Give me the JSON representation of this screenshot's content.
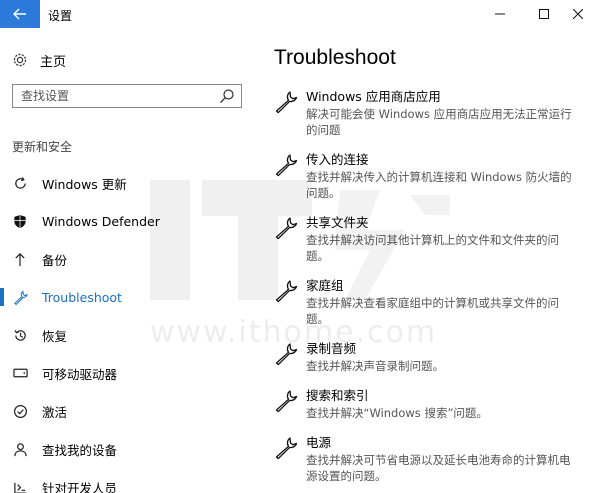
{
  "window": {
    "title": "设置",
    "back_icon": "arrow-left-icon",
    "controls": {
      "minimize": "–",
      "maximize": "☐",
      "close": "✕"
    }
  },
  "sidebar": {
    "home_label": "主页",
    "search_placeholder": "查找设置",
    "section_label": "更新和安全",
    "items": [
      {
        "label": "Windows 更新",
        "icon": "refresh-icon",
        "active": false
      },
      {
        "label": "Windows Defender",
        "icon": "shield-icon",
        "active": false
      },
      {
        "label": "备份",
        "icon": "arrow-up-icon",
        "active": false
      },
      {
        "label": "Troubleshoot",
        "icon": "wrench-icon",
        "active": true
      },
      {
        "label": "恢复",
        "icon": "history-icon",
        "active": false
      },
      {
        "label": "可移动驱动器",
        "icon": "drive-icon",
        "active": false
      },
      {
        "label": "激活",
        "icon": "check-circle-icon",
        "active": false
      },
      {
        "label": "查找我的设备",
        "icon": "person-icon",
        "active": false
      },
      {
        "label": "针对开发人员",
        "icon": "developer-icon",
        "active": false
      }
    ]
  },
  "main": {
    "title": "Troubleshoot",
    "items": [
      {
        "title": "Windows 应用商店应用",
        "desc": "解决可能会使 Windows 应用商店应用无法正常运行的问题"
      },
      {
        "title": "传入的连接",
        "desc": "查找并解决传入的计算机连接和 Windows 防火墙的问题。"
      },
      {
        "title": "共享文件夹",
        "desc": "查找并解决访问其他计算机上的文件和文件夹的问题。"
      },
      {
        "title": "家庭组",
        "desc": "查找并解决查看家庭组中的计算机或共享文件的问题。"
      },
      {
        "title": "录制音频",
        "desc": "查找并解决声音录制问题。"
      },
      {
        "title": "搜索和索引",
        "desc": "查找并解决“Windows 搜索”问题。"
      },
      {
        "title": "电源",
        "desc": "查找并解决可节省电源以及延长电池寿命的计算机电源设置的问题。"
      }
    ]
  },
  "watermark": {
    "text": "www.ithome.com"
  },
  "colors": {
    "accent": "#1a6fc6",
    "back_button": "#2b79d8"
  }
}
